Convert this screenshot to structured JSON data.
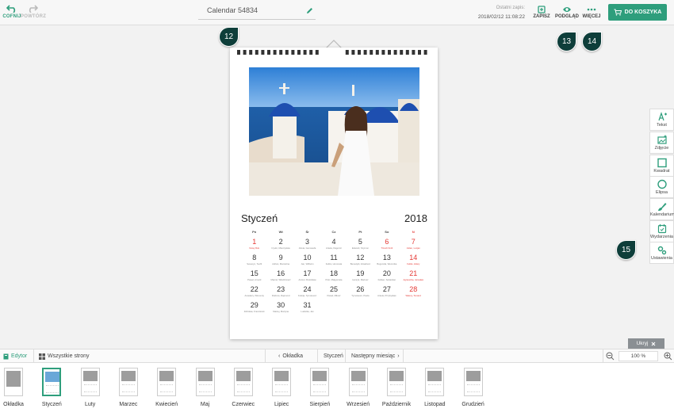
{
  "topbar": {
    "undo_label": "COFNIJ",
    "redo_label": "POWTÓRZ",
    "doc_title": "Calendar 54834",
    "last_save_label": "Ostatni zapis:",
    "last_save_time": "2018/02/12 11:08:22",
    "save_label": "ZAPISZ",
    "preview_label": "PODGLĄD",
    "more_label": "WIĘCEJ",
    "cart_label": "DO KOSZYKA"
  },
  "markers": [
    "12",
    "13",
    "14",
    "15"
  ],
  "calendar": {
    "month": "Styczeń",
    "year": "2018",
    "dow": [
      "Pn",
      "Wt",
      "Śr",
      "Cz",
      "Pt",
      "So",
      "N"
    ],
    "days": [
      {
        "n": "1",
        "note": "Nowy Rok",
        "red": true
      },
      {
        "n": "2",
        "note": "Izydor, Mieczysław",
        "red": false
      },
      {
        "n": "3",
        "note": "Arleta, Genowefa",
        "red": false
      },
      {
        "n": "4",
        "note": "Aniela, Dagomir",
        "red": false
      },
      {
        "n": "5",
        "note": "Edward, Szymon",
        "red": false
      },
      {
        "n": "6",
        "note": "Trzech Króli",
        "red": true
      },
      {
        "n": "7",
        "note": "Julian, Lucjan",
        "red": true
      },
      {
        "n": "8",
        "note": "Seweryn, Teofil",
        "red": false
      },
      {
        "n": "9",
        "note": "Adrian, Marcelina",
        "red": false
      },
      {
        "n": "10",
        "note": "Jan, Wilhelm",
        "red": false
      },
      {
        "n": "11",
        "note": "Feliks, Honorata",
        "red": false
      },
      {
        "n": "12",
        "note": "Benedykt, Arkadiusz",
        "red": false
      },
      {
        "n": "13",
        "note": "Bogumiła, Weronika",
        "red": false
      },
      {
        "n": "14",
        "note": "Feliks, Hilary",
        "red": true
      },
      {
        "n": "15",
        "note": "Paweł, Arnold",
        "red": false
      },
      {
        "n": "16",
        "note": "Marcel, Włodzimierz",
        "red": false
      },
      {
        "n": "17",
        "note": "Antoni, Rościsław",
        "red": false
      },
      {
        "n": "18",
        "note": "Piotr, Małgorzata",
        "red": false
      },
      {
        "n": "19",
        "note": "Henryk, Mariusz",
        "red": false
      },
      {
        "n": "20",
        "note": "Fabian, Sebastian",
        "red": false
      },
      {
        "n": "21",
        "note": "Agnieszka, Jarosław",
        "red": true
      },
      {
        "n": "22",
        "note": "Anastazy, Wincenty",
        "red": false
      },
      {
        "n": "23",
        "note": "Ildefons, Rajmund",
        "red": false
      },
      {
        "n": "24",
        "note": "Felicja, Tymoteusz",
        "red": false
      },
      {
        "n": "25",
        "note": "Paweł, Miłosz",
        "red": false
      },
      {
        "n": "26",
        "note": "Tymoteusz, Paula",
        "red": false
      },
      {
        "n": "27",
        "note": "Aniela, Przybysław",
        "red": false
      },
      {
        "n": "28",
        "note": "Walery, Tomasz",
        "red": true
      },
      {
        "n": "29",
        "note": "Zdzisław, Franciszek",
        "red": false
      },
      {
        "n": "30",
        "note": "Maciej, Martyna",
        "red": false
      },
      {
        "n": "31",
        "note": "Ludwika, Jan",
        "red": false
      }
    ]
  },
  "side_tools": [
    "Tekst",
    "Zdjęcie",
    "Kwadrat",
    "Elipsa",
    "Kalendarium",
    "Wydarzenia",
    "Ustawienia"
  ],
  "hide_label": "Ukryj",
  "bottombar": {
    "editor_label": "Edytor",
    "all_pages_label": "Wszystkie strony",
    "prev_label": "Okładka",
    "current_label": "Styczeń",
    "next_label": "Następny miesiąc",
    "zoom": "100 %"
  },
  "thumbnails": [
    "Okładka",
    "Styczeń",
    "Luty",
    "Marzec",
    "Kwiecień",
    "Maj",
    "Czerwiec",
    "Lipiec",
    "Sierpień",
    "Wrzesień",
    "Październik",
    "Listopad",
    "Grudzień"
  ],
  "colors": {
    "accent": "#2e9e7c",
    "marker": "#0e3e3a",
    "holiday": "#e53935"
  }
}
